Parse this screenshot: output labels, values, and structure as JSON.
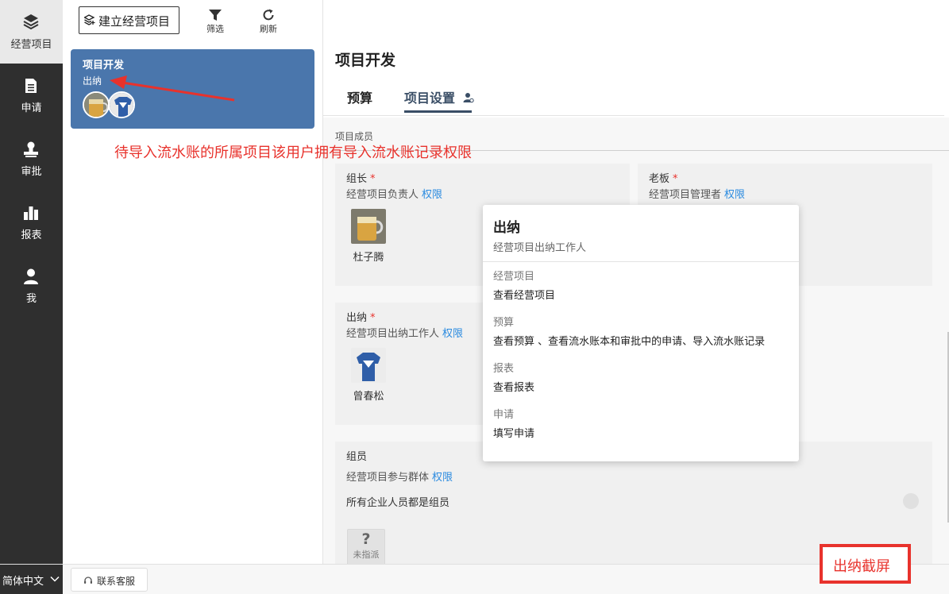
{
  "nav": {
    "items": [
      {
        "label": "经营项目",
        "icon": "layers-icon"
      },
      {
        "label": "申请",
        "icon": "document-icon"
      },
      {
        "label": "审批",
        "icon": "stamp-icon"
      },
      {
        "label": "报表",
        "icon": "bar-chart-icon"
      },
      {
        "label": "我",
        "icon": "user-icon"
      }
    ]
  },
  "list": {
    "new_button": "建立经营项目",
    "filter_label": "筛选",
    "refresh_label": "刷新",
    "card": {
      "title": "项目开发",
      "role": "出纳"
    }
  },
  "annotation": {
    "text": "待导入流水账的所属项目该用户拥有导入流水账记录权限",
    "stamp": "出纳截屏",
    "color": "#e8322c"
  },
  "detail": {
    "title": "项目开发",
    "tabs": [
      {
        "label": "预算"
      },
      {
        "label": "项目设置"
      }
    ],
    "section_label": "项目成员",
    "leader": {
      "title": "组长",
      "required": "*",
      "desc": "经营项目负责人",
      "perm": "权限",
      "member": "杜子腾"
    },
    "boss": {
      "title": "老板",
      "required": "*",
      "desc": "经营项目管理者",
      "perm": "权限"
    },
    "cashier": {
      "title": "出纳",
      "required": "*",
      "desc": "经营项目出纳工作人",
      "perm": "权限",
      "member": "曾春松"
    },
    "members": {
      "title": "组员",
      "desc": "经营项目参与群体",
      "perm": "权限",
      "all_members_text": "所有企业人员都是组员",
      "unassigned_label": "未指派",
      "unassigned_mark": "?"
    }
  },
  "popover": {
    "title": "出纳",
    "subtitle": "经营项目出纳工作人",
    "groups": [
      {
        "heading": "经营项目",
        "value": "查看经营项目"
      },
      {
        "heading": "预算",
        "value": "查看预算 、查看流水账本和审批中的申请、导入流水账记录"
      },
      {
        "heading": "报表",
        "value": "查看报表"
      },
      {
        "heading": "申请",
        "value": "填写申请"
      }
    ]
  },
  "bottom": {
    "language": "简体中文",
    "support": "联系客服"
  },
  "colors": {
    "nav_bg": "#2f2f2f",
    "card_bg": "#4a76ac",
    "link": "#2b8be0",
    "tab_active": "#3a4e66"
  }
}
